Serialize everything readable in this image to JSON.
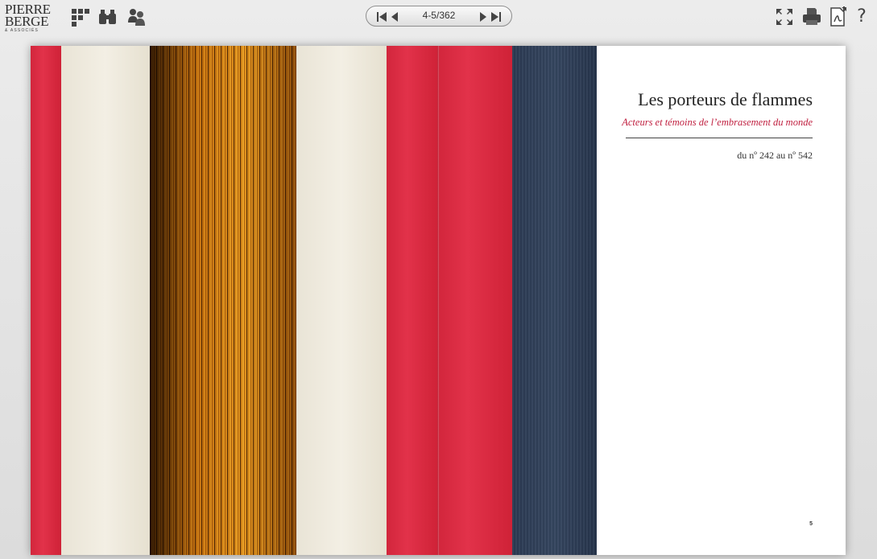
{
  "brand": {
    "line1": "PIERRE",
    "line2": "BERGE",
    "line3": "& ASSOCIÉS"
  },
  "toolbar": {
    "left_icons": [
      "thumbnails-icon",
      "search-binoculars-icon",
      "share-people-icon"
    ],
    "right_icons": [
      "fullscreen-icon",
      "print-icon",
      "pdf-download-icon",
      "help-icon"
    ],
    "help_label": "?"
  },
  "pager": {
    "page_indicator": "4-5/362"
  },
  "page": {
    "title": "Les porteurs de flammes",
    "subtitle": "Acteurs et témoins de l’embrasement du monde",
    "range": "du nº 242 au nº 542",
    "folio": "5"
  },
  "colors": {
    "accent_red": "#c02040",
    "stripe_red": "#e2324a",
    "stripe_cream": "#f3efe4",
    "stripe_navy": "#34455f"
  }
}
